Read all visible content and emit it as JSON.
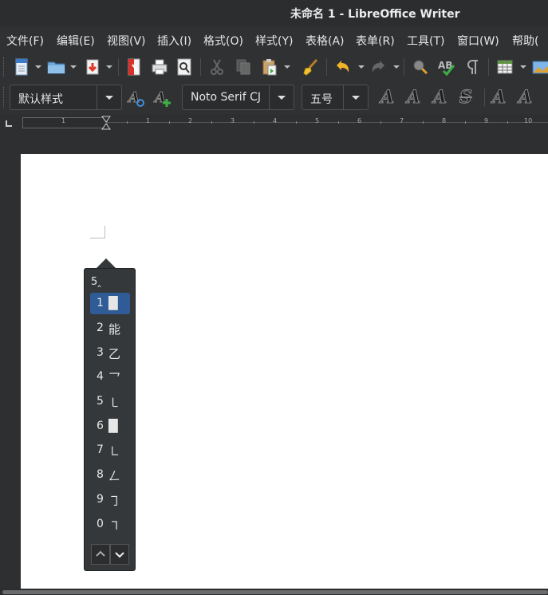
{
  "window": {
    "title": "未命名 1 - LibreOffice Writer"
  },
  "menubar": [
    "文件(F)",
    "编辑(E)",
    "视图(V)",
    "插入(I)",
    "格式(O)",
    "样式(Y)",
    "表格(A)",
    "表单(R)",
    "工具(T)",
    "窗口(W)",
    "帮助("
  ],
  "formatting": {
    "paragraph_style": "默认样式",
    "font_name": "Noto Serif CJ",
    "font_size": "五号",
    "letters": {
      "A": "A",
      "strike": "S"
    }
  },
  "ruler": {
    "numbers": [
      "1",
      "1",
      "2",
      "3",
      "4",
      "5",
      "6",
      "7",
      "8",
      "9",
      "10"
    ]
  },
  "ime": {
    "preedit": "5‸",
    "candidates": [
      {
        "num": "1",
        "char": "█"
      },
      {
        "num": "2",
        "char": "能"
      },
      {
        "num": "3",
        "char": "乙"
      },
      {
        "num": "4",
        "char": "乛"
      },
      {
        "num": "5",
        "char": "㇄"
      },
      {
        "num": "6",
        "char": "█"
      },
      {
        "num": "7",
        "char": "㇗"
      },
      {
        "num": "8",
        "char": "𠃋"
      },
      {
        "num": "9",
        "char": "㇆"
      },
      {
        "num": "0",
        "char": "㇕"
      }
    ],
    "selected_index": 0
  },
  "colors": {
    "selection": "#2f5c97",
    "page": "#ffffff",
    "chrome": "#2f3133",
    "accent_orange": "#f0a030"
  }
}
